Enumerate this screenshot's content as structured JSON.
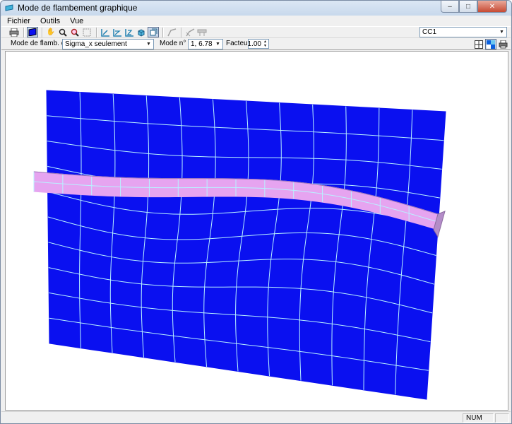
{
  "window": {
    "title": "Mode de flambement graphique"
  },
  "menu": [
    "Fichier",
    "Outils",
    "Vue"
  ],
  "toolbar": {
    "load_case": {
      "value": "CC1"
    }
  },
  "options": {
    "mode_flamb_label": "Mode de flamb. de :",
    "mode_flamb_value": "Sigma_x seulement",
    "mode_n_label": "Mode n° :",
    "mode_n_value": "1, 6.78",
    "facteur_label": "Facteur :",
    "facteur_value": "1.00"
  },
  "colors": {
    "plate": "#0a10f0",
    "mesh": "#b8f2ff",
    "stiffener": "#e6a4f0"
  },
  "statusbar": {
    "num": "NUM"
  }
}
